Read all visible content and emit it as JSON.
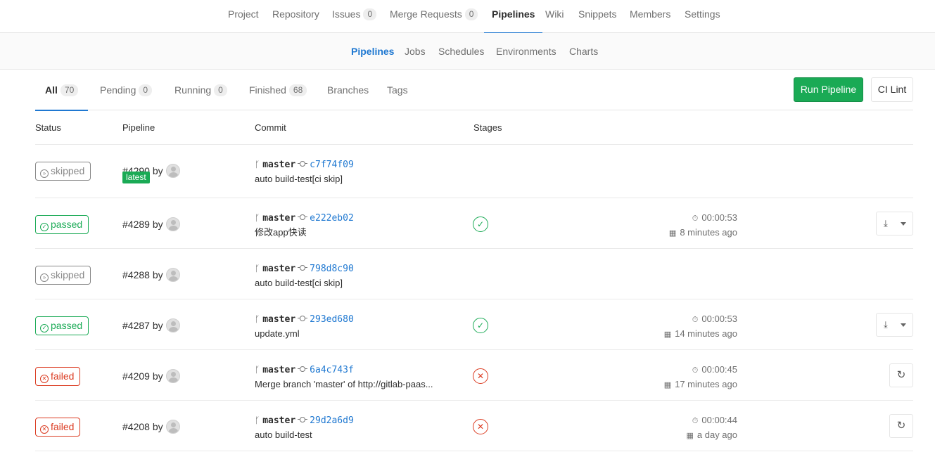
{
  "project_nav": {
    "items": [
      {
        "label": "Project"
      },
      {
        "label": "Repository"
      },
      {
        "label": "Issues",
        "count": "0"
      },
      {
        "label": "Merge Requests",
        "count": "0"
      },
      {
        "label": "Pipelines",
        "active": true
      },
      {
        "label": "Wiki"
      },
      {
        "label": "Snippets"
      },
      {
        "label": "Members"
      },
      {
        "label": "Settings"
      }
    ]
  },
  "sub_nav": {
    "items": [
      {
        "label": "Pipelines",
        "active": true
      },
      {
        "label": "Jobs"
      },
      {
        "label": "Schedules"
      },
      {
        "label": "Environments"
      },
      {
        "label": "Charts"
      }
    ]
  },
  "scope_tabs": [
    {
      "label": "All",
      "count": "70",
      "active": true
    },
    {
      "label": "Pending",
      "count": "0"
    },
    {
      "label": "Running",
      "count": "0"
    },
    {
      "label": "Finished",
      "count": "68"
    },
    {
      "label": "Branches"
    },
    {
      "label": "Tags"
    }
  ],
  "actions": {
    "run_pipeline": "Run Pipeline",
    "ci_lint": "CI Lint"
  },
  "table": {
    "headers": {
      "status": "Status",
      "pipeline": "Pipeline",
      "commit": "Commit",
      "stages": "Stages"
    },
    "by_label": "by",
    "rows": [
      {
        "status": "skipped",
        "status_icon": "skipped-icon",
        "id": "#4290",
        "badge": "latest",
        "branch": "master",
        "sha": "c7f74f09",
        "message": "auto build-test[ci skip]",
        "stage": null,
        "duration": null,
        "finished": null,
        "action": null
      },
      {
        "status": "passed",
        "status_icon": "check-circle-icon",
        "id": "#4289",
        "branch": "master",
        "sha": "e222eb02",
        "message": "修改app快读",
        "stage": "success",
        "duration": "00:00:53",
        "finished": "8 minutes ago",
        "action": "download"
      },
      {
        "status": "skipped",
        "status_icon": "skipped-icon",
        "id": "#4288",
        "branch": "master",
        "sha": "798d8c90",
        "message": "auto build-test[ci skip]",
        "stage": null,
        "duration": null,
        "finished": null,
        "action": null
      },
      {
        "status": "passed",
        "status_icon": "check-circle-icon",
        "id": "#4287",
        "branch": "master",
        "sha": "293ed680",
        "message": "update.yml",
        "stage": "success",
        "duration": "00:00:53",
        "finished": "14 minutes ago",
        "action": "download"
      },
      {
        "status": "failed",
        "status_icon": "x-circle-icon",
        "id": "#4209",
        "branch": "master",
        "sha": "6a4c743f",
        "message": "Merge branch 'master' of http://gitlab-paas...",
        "stage": "failed",
        "duration": "00:00:45",
        "finished": "17 minutes ago",
        "action": "retry"
      },
      {
        "status": "failed",
        "status_icon": "x-circle-icon",
        "id": "#4208",
        "branch": "master",
        "sha": "29d2a6d9",
        "message": "auto build-test",
        "stage": "failed",
        "duration": "00:00:44",
        "finished": "a day ago",
        "action": "retry"
      }
    ]
  },
  "colors": {
    "accent_blue": "#1f78d1",
    "success_green": "#1aaa55",
    "failed_red": "#db3b21",
    "skipped_gray": "#888888"
  }
}
